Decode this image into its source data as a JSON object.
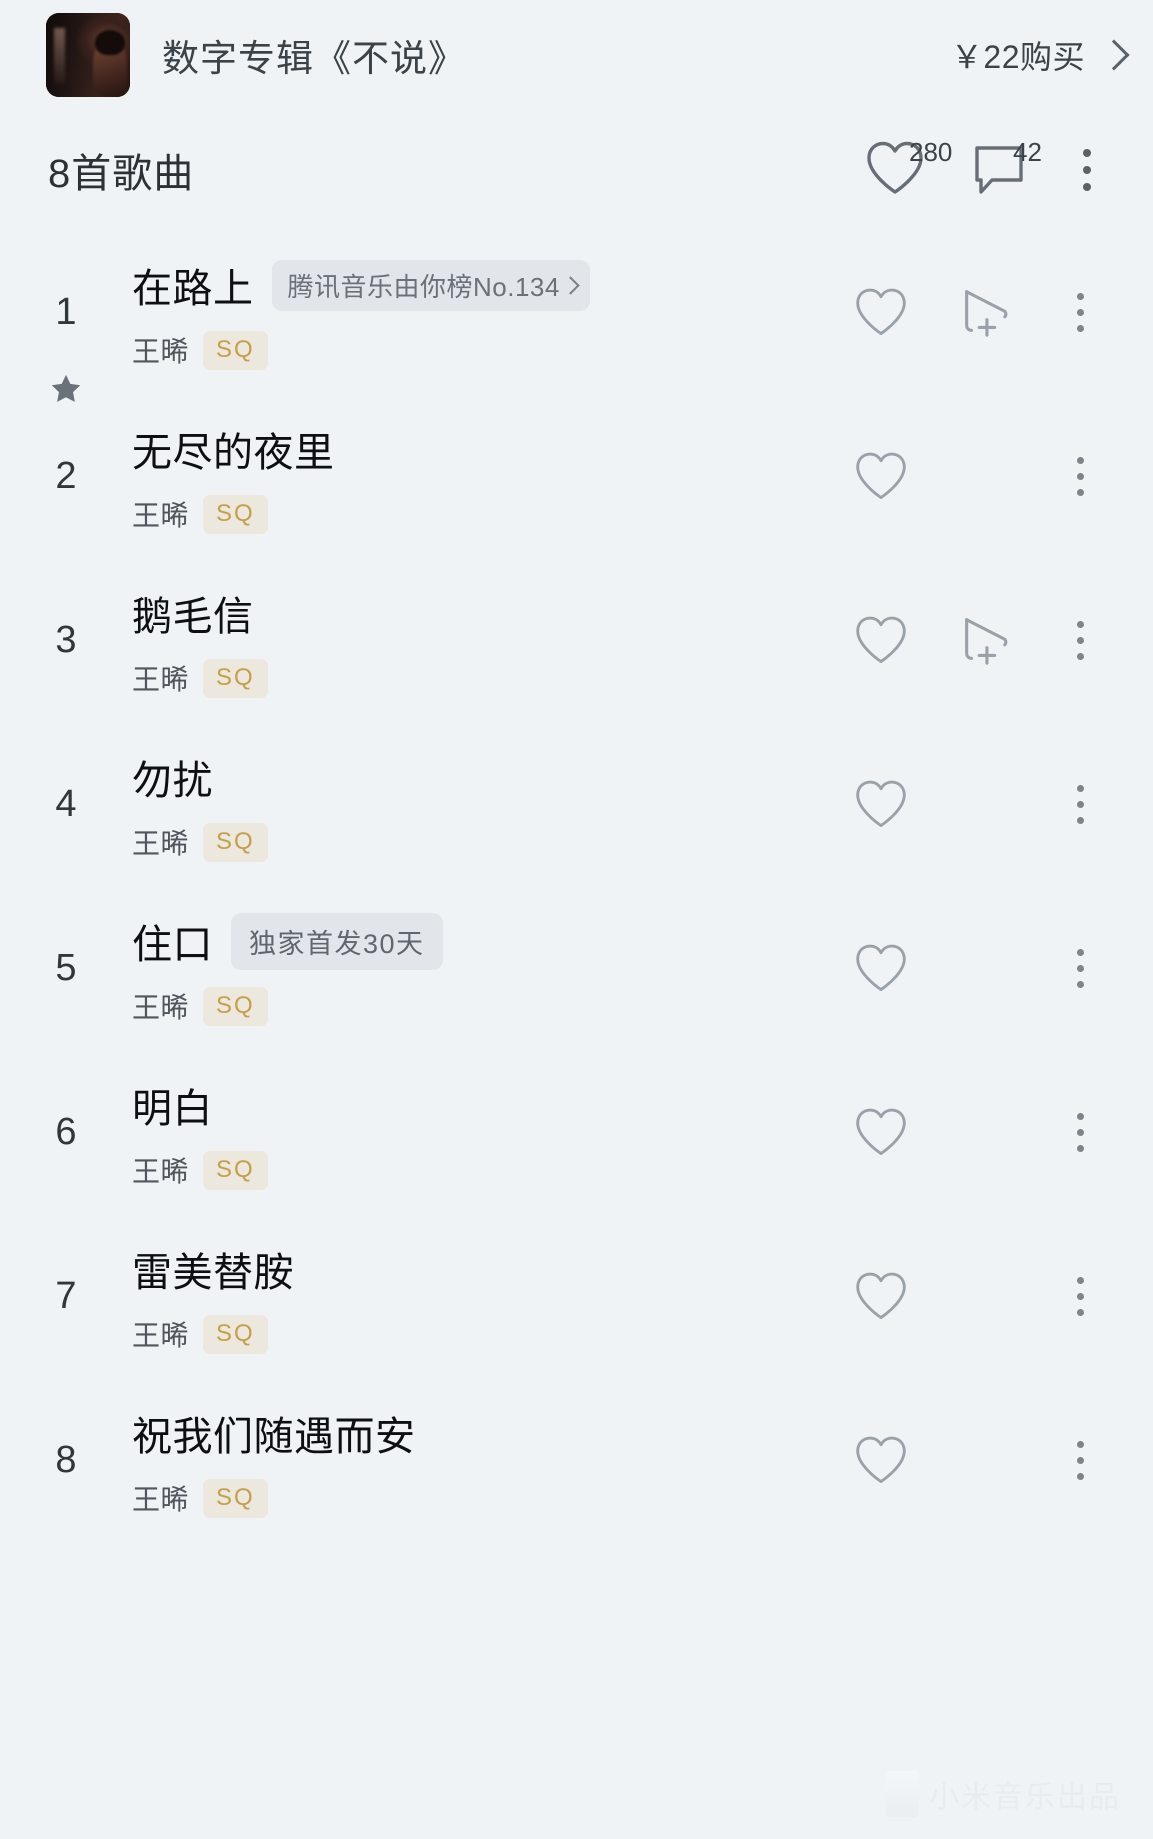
{
  "promo": {
    "album_art_alt": "album-cover",
    "title": "数字专辑《不说》",
    "price": "￥22购买",
    "chevron_icon": "chevron-right-icon"
  },
  "list_header": {
    "count_text": "8首歌曲",
    "like_icon": "heart-icon",
    "like_count": "280",
    "comment_icon": "comment-icon",
    "comment_count": "42",
    "more_icon": "more-vertical-icon"
  },
  "icons": {
    "heart": "heart-icon",
    "add_to_playlist": "play-next-add-icon",
    "more": "more-vertical-icon",
    "star": "star-icon"
  },
  "songs": [
    {
      "index": "1",
      "title": "在路上",
      "badge": "腾讯音乐由你榜No.134",
      "badge_type": "rank",
      "artist": "王晞",
      "quality": "SQ",
      "starred": true,
      "has_add_button": true
    },
    {
      "index": "2",
      "title": "无尽的夜里",
      "badge": "",
      "badge_type": "none",
      "artist": "王晞",
      "quality": "SQ",
      "starred": false,
      "has_add_button": false
    },
    {
      "index": "3",
      "title": "鹅毛信",
      "badge": "",
      "badge_type": "none",
      "artist": "王晞",
      "quality": "SQ",
      "starred": false,
      "has_add_button": true
    },
    {
      "index": "4",
      "title": "勿扰",
      "badge": "",
      "badge_type": "none",
      "artist": "王晞",
      "quality": "SQ",
      "starred": false,
      "has_add_button": false
    },
    {
      "index": "5",
      "title": "住口",
      "badge": "独家首发30天",
      "badge_type": "exclusive",
      "artist": "王晞",
      "quality": "SQ",
      "starred": false,
      "has_add_button": false
    },
    {
      "index": "6",
      "title": "明白",
      "badge": "",
      "badge_type": "none",
      "artist": "王晞",
      "quality": "SQ",
      "starred": false,
      "has_add_button": false
    },
    {
      "index": "7",
      "title": "雷美替胺",
      "badge": "",
      "badge_type": "none",
      "artist": "王晞",
      "quality": "SQ",
      "starred": false,
      "has_add_button": false
    },
    {
      "index": "8",
      "title": "祝我们随遇而安",
      "badge": "",
      "badge_type": "none",
      "artist": "王晞",
      "quality": "SQ",
      "starred": false,
      "has_add_button": false
    }
  ],
  "watermark": {
    "text": "小米音乐出品"
  },
  "colors": {
    "background": "#eff3f6",
    "title_text": "#0d0f12",
    "secondary_text": "#50565c",
    "sq_gold": "#c3a04b",
    "badge_bg": "#e2e6ea",
    "icon_gray": "#8a9199"
  }
}
